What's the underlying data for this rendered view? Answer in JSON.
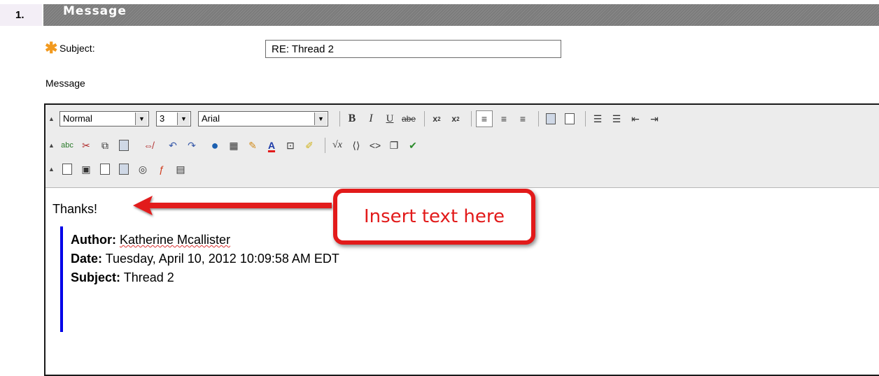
{
  "section": {
    "number": "1.",
    "title": "Message"
  },
  "subject": {
    "label": "Subject:",
    "value": "RE: Thread 2"
  },
  "message_label": "Message",
  "toolbar": {
    "format_value": "Normal",
    "size_value": "3",
    "font_value": "Arial",
    "row1_icons": [
      "bold-icon",
      "italic-icon",
      "underline-icon",
      "strikethrough-icon",
      "subscript-icon",
      "superscript-icon",
      "align-left-icon",
      "align-center-icon",
      "align-right-icon",
      "paste-text-icon",
      "paste-word-icon",
      "numbered-list-icon",
      "bullet-list-icon",
      "outdent-icon",
      "indent-icon"
    ],
    "row2_icons": [
      "spellcheck-icon",
      "cut-icon",
      "copy-icon",
      "paste-icon",
      "unlink-icon",
      "undo-icon",
      "redo-icon",
      "link-icon",
      "table-icon",
      "pencil-icon",
      "text-color-icon",
      "media-icon",
      "highlight-icon",
      "math-icon",
      "code-icon",
      "html-icon",
      "fullscreen-icon",
      "check-icon"
    ],
    "row3_icons": [
      "attach-file-icon",
      "insert-image-icon",
      "insert-media-icon",
      "preview-icon",
      "mashup-icon",
      "flash-icon",
      "spreadsheet-icon"
    ]
  },
  "content": {
    "thanks": "Thanks!",
    "author_label": "Author:",
    "author_value": "Katherine Mcallister",
    "date_label": "Date:",
    "date_value": "Tuesday, April 10, 2012 10:09:58 AM EDT",
    "subject_label": "Subject:",
    "subject_value": "Thread 2"
  },
  "annotation": {
    "text": "Insert text here",
    "color": "#e21a1a"
  }
}
